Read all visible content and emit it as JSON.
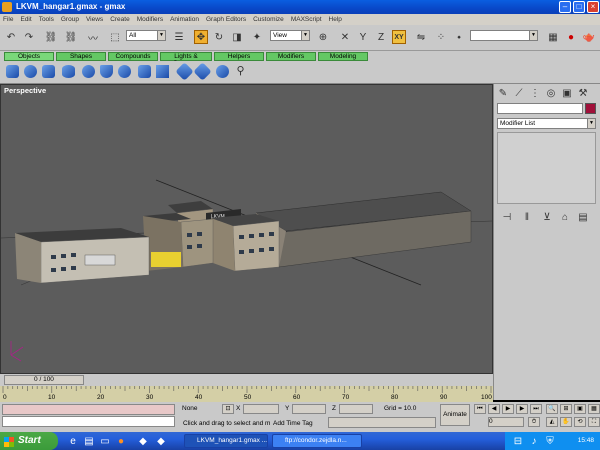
{
  "window": {
    "title": "LKVM_hangar1.gmax - gmax"
  },
  "menu": [
    "File",
    "Edit",
    "Tools",
    "Group",
    "Views",
    "Create",
    "Modifiers",
    "Animation",
    "Graph Editors",
    "Customize",
    "MAXScript",
    "Help"
  ],
  "toolbar": {
    "selection_filter": "All",
    "ref_coord": "View",
    "axis_label": "XY"
  },
  "tabs": [
    "Objects",
    "Shapes",
    "Compounds",
    "Lights & Cameras",
    "Helpers",
    "Modifiers",
    "Modeling"
  ],
  "viewport": {
    "label": "Perspective",
    "sign_text": "LKVM"
  },
  "command_panel": {
    "modifier_list": "Modifier List"
  },
  "time": {
    "slider": "0 / 100",
    "ticks": [
      "0",
      "10",
      "20",
      "30",
      "40",
      "50",
      "60",
      "70",
      "80",
      "90",
      "100"
    ]
  },
  "status": {
    "selection": "None",
    "x_label": "X",
    "y_label": "Y",
    "z_label": "Z",
    "grid": "Grid = 10.0",
    "animate": "Animate",
    "prompt": "Click and drag to select and m",
    "add_time_tag": "Add Time Tag",
    "frame": "0"
  },
  "taskbar": {
    "start": "Start",
    "tasks": [
      "LKVM_hangar1.gmax ...",
      "ftp://condor.zejdla.n..."
    ],
    "clock": "15:48"
  },
  "colors": {
    "title": "#0a5ee0",
    "tab_green": "#64c864",
    "viewport": "#5c5c5c",
    "taskbar": "#245edb",
    "start": "#3b9b3a"
  }
}
